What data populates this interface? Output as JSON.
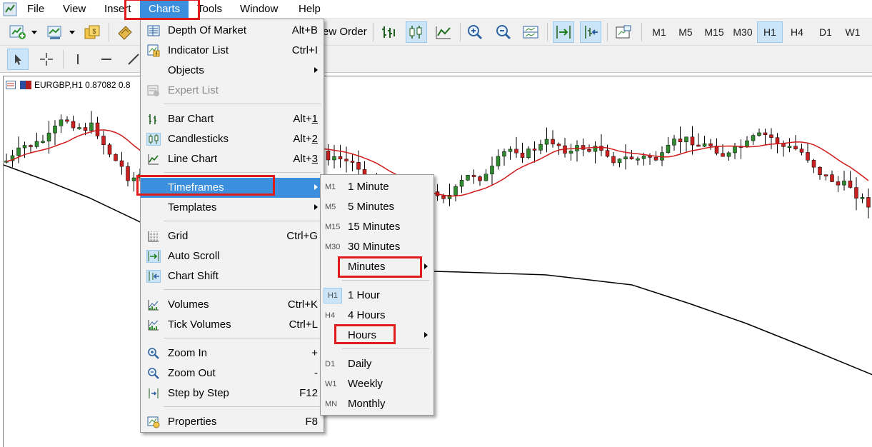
{
  "menubar": {
    "items": [
      "File",
      "View",
      "Insert",
      "Charts",
      "Tools",
      "Window",
      "Help"
    ],
    "active": "Charts"
  },
  "toolbar": {
    "new_order_label": "ew Order",
    "timeframes": [
      "M1",
      "M5",
      "M15",
      "M30",
      "H1",
      "H4",
      "D1",
      "W1"
    ],
    "active_timeframe": "H1"
  },
  "chart": {
    "title": "EURGBP,H1  0.87082 0.8"
  },
  "charts_menu": {
    "items": [
      {
        "label": "Depth Of Market",
        "shortcut": "Alt+B"
      },
      {
        "label": "Indicator List",
        "shortcut": "Ctrl+I"
      },
      {
        "label": "Objects",
        "submenu": true
      },
      {
        "label": "Expert List",
        "disabled": true
      },
      {
        "label": "Bar Chart",
        "shortcut": "Alt+1"
      },
      {
        "label": "Candlesticks",
        "shortcut": "Alt+2"
      },
      {
        "label": "Line Chart",
        "shortcut": "Alt+3"
      },
      {
        "label": "Timeframes",
        "submenu": true,
        "highlighted": true
      },
      {
        "label": "Templates",
        "submenu": true
      },
      {
        "label": "Grid",
        "shortcut": "Ctrl+G"
      },
      {
        "label": "Auto Scroll",
        "shortcut": ""
      },
      {
        "label": "Chart Shift",
        "shortcut": ""
      },
      {
        "label": "Volumes",
        "shortcut": "Ctrl+K"
      },
      {
        "label": "Tick Volumes",
        "shortcut": "Ctrl+L"
      },
      {
        "label": "Zoom In",
        "shortcut": "+"
      },
      {
        "label": "Zoom Out",
        "shortcut": "-"
      },
      {
        "label": "Step by Step",
        "shortcut": "F12"
      },
      {
        "label": "Properties",
        "shortcut": "F8"
      }
    ]
  },
  "timeframes_menu": {
    "items": [
      {
        "code": "M1",
        "label": "1 Minute"
      },
      {
        "code": "M5",
        "label": "5 Minutes"
      },
      {
        "code": "M15",
        "label": "15 Minutes"
      },
      {
        "code": "M30",
        "label": "30 Minutes"
      },
      {
        "code": "",
        "label": "Minutes",
        "submenu": true
      },
      {
        "code": "H1",
        "label": "1 Hour",
        "checked": true
      },
      {
        "code": "H4",
        "label": "4 Hours"
      },
      {
        "code": "",
        "label": "Hours",
        "submenu": true
      },
      {
        "code": "D1",
        "label": "Daily"
      },
      {
        "code": "W1",
        "label": "Weekly"
      },
      {
        "code": "MN",
        "label": "Monthly"
      }
    ]
  },
  "colors": {
    "accent": "#3c8fdc",
    "highlight_box": "#e01b1b",
    "bull_candle": "#2e8b2e",
    "bear_candle": "#cc1f1f",
    "ma_fast": "#d11a1a",
    "ma_slow": "#000000"
  }
}
